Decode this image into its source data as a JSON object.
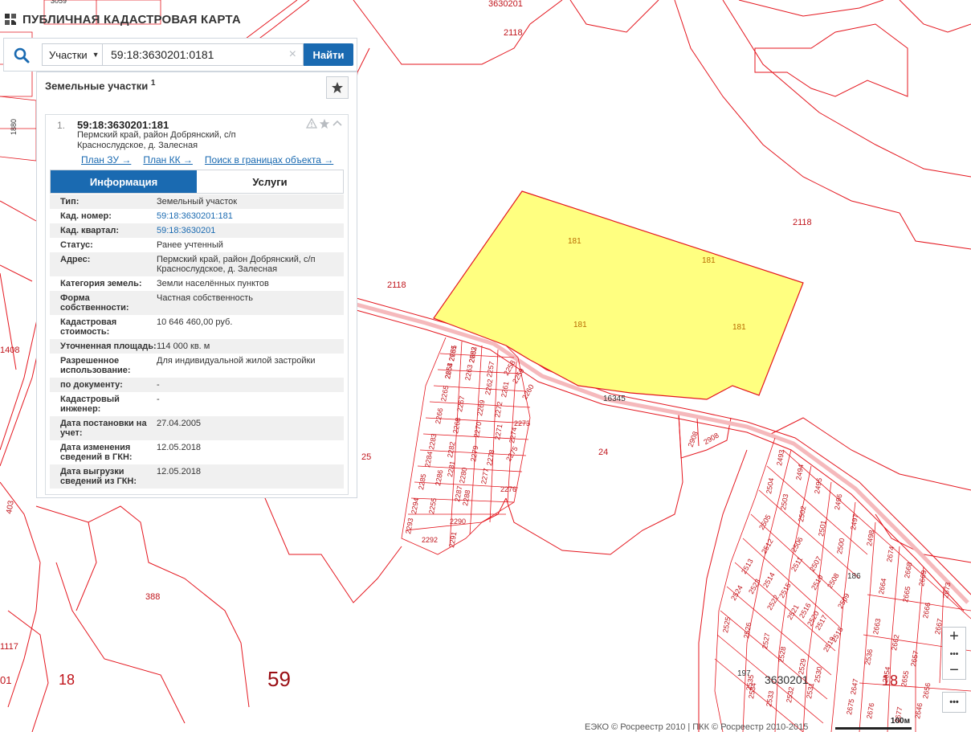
{
  "app": {
    "title": "ПУБЛИЧНАЯ КАДАСТРОВАЯ КАРТА"
  },
  "search": {
    "type_label": "Участки",
    "query": "59:18:3630201:0181",
    "clear_symbol": "×",
    "find_label": "Найти"
  },
  "results": {
    "header": "Земельные участки",
    "count": "1",
    "item": {
      "number": "1.",
      "cadnum": "59:18:3630201:181",
      "address": "Пермский край, район Добрянский, с/п Краснослудское, д. Залесная",
      "links": [
        "План ЗУ →",
        "План КК →",
        "Поиск в границах объекта →"
      ],
      "tabs": {
        "info": "Информация",
        "services": "Услуги"
      },
      "rows": [
        {
          "key": "Тип:",
          "value": "Земельный участок"
        },
        {
          "key": "Кад. номер:",
          "value": "59:18:3630201:181",
          "link": true
        },
        {
          "key": "Кад. квартал:",
          "value": "59:18:3630201",
          "link": true
        },
        {
          "key": "Статус:",
          "value": "Ранее учтенный"
        },
        {
          "key": "Адрес:",
          "value": "Пермский край, район Добрянский, с/п Краснослудское, д. Залесная"
        },
        {
          "key": "Категория земель:",
          "value": "Земли населённых пунктов"
        },
        {
          "key": "Форма собственности:",
          "value": "Частная собственность"
        },
        {
          "key": "Кадастровая стоимость:",
          "value": "10 646 460,00 руб."
        },
        {
          "key": "Уточненная площадь:",
          "value": "114 000 кв. м"
        },
        {
          "key": "Разрешенное использование:",
          "value": "Для индивидуальной жилой застройки"
        },
        {
          "key": "по документу:",
          "value": "-"
        },
        {
          "key": "Кадастровый инженер:",
          "value": "-"
        },
        {
          "key": "Дата постановки на учет:",
          "value": "27.04.2005"
        },
        {
          "key": "Дата изменения сведений в ГКН:",
          "value": "12.05.2018"
        },
        {
          "key": "Дата выгрузки сведений из ГКН:",
          "value": "12.05.2018"
        }
      ]
    }
  },
  "map": {
    "parcel_color": "#ffff80",
    "line_color": "#e4161e",
    "labels": {
      "block_top": "3630201",
      "l2118a": "2118",
      "l2118b": "2118",
      "l2118c": "2118",
      "p181a": "181",
      "p181b": "181",
      "p181c": "181",
      "p181d": "181",
      "l16345": "16345",
      "l24": "24",
      "l25": "25",
      "l2908a": "2908",
      "l2908b": "2908",
      "l388": "388",
      "l1408": "1408",
      "l1117": "1117",
      "l403": "403",
      "l18a": "18",
      "l59": "59",
      "l18b": "18",
      "block_bottom": "3630201",
      "l186": "186",
      "l197": "197",
      "l3059": "3059",
      "l1880": "1880",
      "l01": "01"
    },
    "small_labels": [
      "2785",
      "2783",
      "2264",
      "2263",
      "2257",
      "2258",
      "2259",
      "2260",
      "2262",
      "2261",
      "2265",
      "2266",
      "2267",
      "2268",
      "2269",
      "2270",
      "2272",
      "2273",
      "2271",
      "2274",
      "2275",
      "2276",
      "2283",
      "2282",
      "2281",
      "2280",
      "2279",
      "2278",
      "2277",
      "2284",
      "2285",
      "2286",
      "2287",
      "2288",
      "2294",
      "2293",
      "2292",
      "2291",
      "2290",
      "2255",
      "2493",
      "2494",
      "2495",
      "2496",
      "2497",
      "2498",
      "2504",
      "2503",
      "2502",
      "2501",
      "2500",
      "2505",
      "2506",
      "2507",
      "2508",
      "2509",
      "2510",
      "2511",
      "2512",
      "2513",
      "2514",
      "2515",
      "2516",
      "2517",
      "2518",
      "2519",
      "2520",
      "2521",
      "2522",
      "2523",
      "2524",
      "2525",
      "2526",
      "2527",
      "2528",
      "2529",
      "2530",
      "2531",
      "2532",
      "2533",
      "2534",
      "2535",
      "2536",
      "2654",
      "2655",
      "2656",
      "2657",
      "2662",
      "2663",
      "2664",
      "2665",
      "2666",
      "2667",
      "2668",
      "2669",
      "2673",
      "2674",
      "2675",
      "2676",
      "2677",
      "2646",
      "2647",
      "2651",
      "2652",
      "2653"
    ],
    "scale": "100м"
  },
  "controls": {
    "zoom_in": "+",
    "zoom_out": "−",
    "more": "•••"
  },
  "copyright": "ЕЭКО © Росреестр 2010 | ПКК © Росреестр 2010-2015"
}
